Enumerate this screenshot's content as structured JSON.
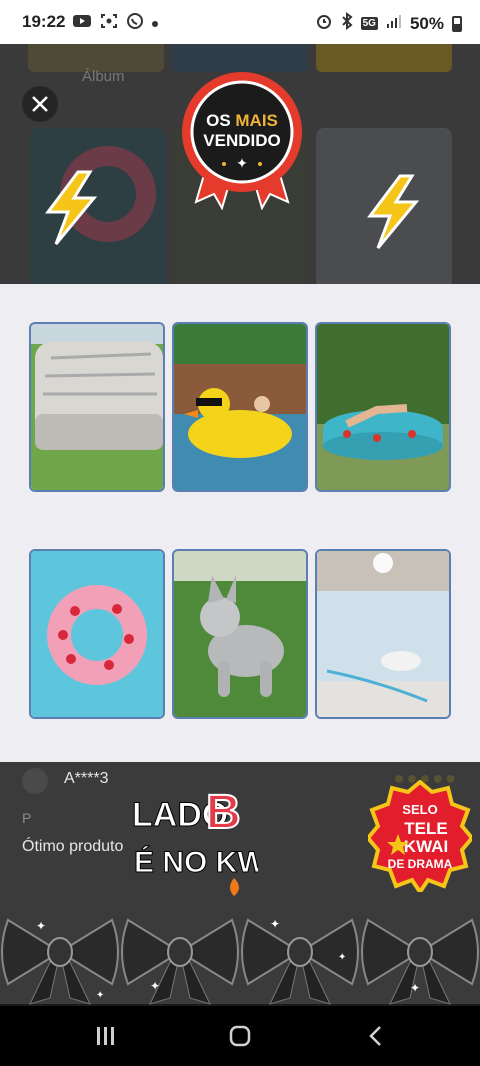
{
  "status_bar": {
    "time": "19:22",
    "battery": "50%",
    "network": "5G",
    "left_icons": [
      "youtube-icon",
      "screenshot-icon",
      "whatsapp-icon",
      "notification-dot"
    ],
    "right_icons": [
      "alarm-icon",
      "bluetooth-icon",
      "5g-icon",
      "signal-icon",
      "battery-icon"
    ]
  },
  "background_page": {
    "album_label": "Álbum"
  },
  "badge": {
    "line1_a": "OS",
    "line1_b": "MAIS",
    "line2": "VENDIDO",
    "colors": {
      "ring": "#e43b2c",
      "center": "#1b1b1b",
      "accent": "#f0b23a"
    }
  },
  "products": [
    {
      "name": "air-mattress",
      "label": ""
    },
    {
      "name": "duck-float",
      "label": ""
    },
    {
      "name": "watermelon-pool",
      "label": ""
    },
    {
      "name": "strawberry-ring",
      "label": ""
    },
    {
      "name": "inflatable-dog",
      "label": ""
    },
    {
      "name": "water-bed",
      "label": ""
    }
  ],
  "review": {
    "reviewer": "A****3",
    "rating_letter": "P",
    "text": "Ótimo produto"
  },
  "overlays": {
    "lado_b": {
      "l1": "LADO",
      "l2": "B",
      "l3": "É NO KWAI"
    },
    "selo": {
      "l1": "SELO",
      "l2": "TELE",
      "l3": "KWAI",
      "l4": "DE DRAMA"
    }
  },
  "nav": {
    "recents": "recents-icon",
    "home": "home-icon",
    "back": "back-icon"
  }
}
